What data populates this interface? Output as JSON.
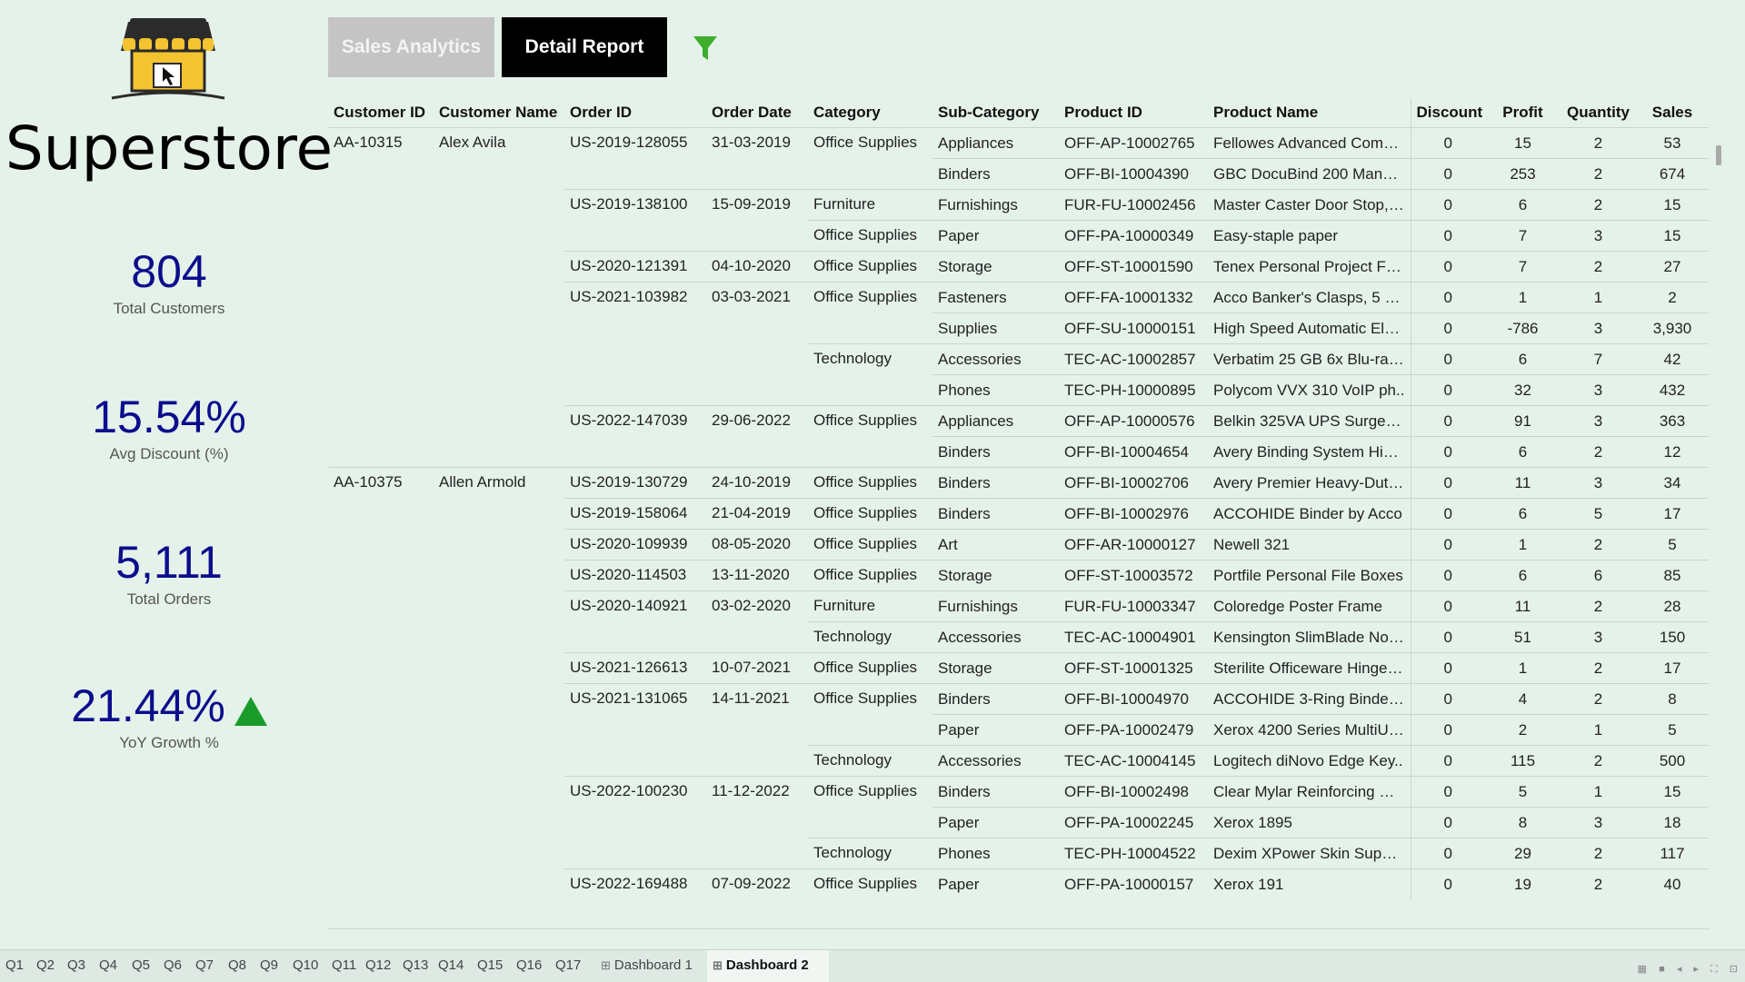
{
  "brand": {
    "title": "Superstore"
  },
  "kpis": {
    "customers": {
      "value": "804",
      "label": "Total Customers"
    },
    "discount": {
      "value": "15.54%",
      "label": "Avg Discount (%)"
    },
    "orders": {
      "value": "5,111",
      "label": "Total Orders"
    },
    "growth": {
      "value": "21.44%",
      "label": "YoY Growth %",
      "trend": "up",
      "arrow_color": "#1a9c2a"
    }
  },
  "nav": {
    "sales_label": "Sales Analytics",
    "detail_label": "Detail Report",
    "filter_icon": "filter-icon",
    "filter_color": "#3dae2b"
  },
  "table": {
    "headers": [
      "Customer ID",
      "Customer Name",
      "Order ID",
      "Order Date",
      "Category",
      "Sub-Category",
      "Product ID",
      "Product Name",
      "Discount",
      "Profit",
      "Quantity",
      "Sales"
    ],
    "rows": [
      [
        "AA-10315",
        "Alex Avila",
        "US-2019-128055",
        "31-03-2019",
        "Office Supplies",
        "Appliances",
        "OFF-AP-10002765",
        "Fellowes Advanced Compu..",
        "0",
        "15",
        "2",
        "53"
      ],
      [
        "",
        "",
        "",
        "",
        "",
        "Binders",
        "OFF-BI-10004390",
        "GBC DocuBind 200 Manual..",
        "0",
        "253",
        "2",
        "674"
      ],
      [
        "",
        "",
        "US-2019-138100",
        "15-09-2019",
        "Furniture",
        "Furnishings",
        "FUR-FU-10002456",
        "Master Caster Door Stop, L..",
        "0",
        "6",
        "2",
        "15"
      ],
      [
        "",
        "",
        "",
        "",
        "Office Supplies",
        "Paper",
        "OFF-PA-10000349",
        "Easy-staple paper",
        "0",
        "7",
        "3",
        "15"
      ],
      [
        "",
        "",
        "US-2020-121391",
        "04-10-2020",
        "Office Supplies",
        "Storage",
        "OFF-ST-10001590",
        "Tenex Personal Project File..",
        "0",
        "7",
        "2",
        "27"
      ],
      [
        "",
        "",
        "US-2021-103982",
        "03-03-2021",
        "Office Supplies",
        "Fasteners",
        "OFF-FA-10001332",
        "Acco Banker's Clasps, 5 3/..",
        "0",
        "1",
        "1",
        "2"
      ],
      [
        "",
        "",
        "",
        "",
        "",
        "Supplies",
        "OFF-SU-10000151",
        "High Speed Automatic Elec..",
        "0",
        "-786",
        "3",
        "3,930"
      ],
      [
        "",
        "",
        "",
        "",
        "Technology",
        "Accessories",
        "TEC-AC-10002857",
        "Verbatim 25 GB 6x Blu-ray ..",
        "0",
        "6",
        "7",
        "42"
      ],
      [
        "",
        "",
        "",
        "",
        "",
        "Phones",
        "TEC-PH-10000895",
        "Polycom VVX 310 VoIP ph..",
        "0",
        "32",
        "3",
        "432"
      ],
      [
        "",
        "",
        "US-2022-147039",
        "29-06-2022",
        "Office Supplies",
        "Appliances",
        "OFF-AP-10000576",
        "Belkin 325VA UPS Surge P..",
        "0",
        "91",
        "3",
        "363"
      ],
      [
        "",
        "",
        "",
        "",
        "",
        "Binders",
        "OFF-BI-10004654",
        "Avery Binding System Hidd..",
        "0",
        "6",
        "2",
        "12"
      ],
      [
        "AA-10375",
        "Allen Armold",
        "US-2019-130729",
        "24-10-2019",
        "Office Supplies",
        "Binders",
        "OFF-BI-10002706",
        "Avery Premier Heavy-Duty ..",
        "0",
        "11",
        "3",
        "34"
      ],
      [
        "",
        "",
        "US-2019-158064",
        "21-04-2019",
        "Office Supplies",
        "Binders",
        "OFF-BI-10002976",
        "ACCOHIDE Binder by Acco",
        "0",
        "6",
        "5",
        "17"
      ],
      [
        "",
        "",
        "US-2020-109939",
        "08-05-2020",
        "Office Supplies",
        "Art",
        "OFF-AR-10000127",
        "Newell 321",
        "0",
        "1",
        "2",
        "5"
      ],
      [
        "",
        "",
        "US-2020-114503",
        "13-11-2020",
        "Office Supplies",
        "Storage",
        "OFF-ST-10003572",
        "Portfile Personal File Boxes",
        "0",
        "6",
        "6",
        "85"
      ],
      [
        "",
        "",
        "US-2020-140921",
        "03-02-2020",
        "Furniture",
        "Furnishings",
        "FUR-FU-10003347",
        "Coloredge Poster Frame",
        "0",
        "11",
        "2",
        "28"
      ],
      [
        "",
        "",
        "",
        "",
        "Technology",
        "Accessories",
        "TEC-AC-10004901",
        "Kensington SlimBlade Note..",
        "0",
        "51",
        "3",
        "150"
      ],
      [
        "",
        "",
        "US-2021-126613",
        "10-07-2021",
        "Office Supplies",
        "Storage",
        "OFF-ST-10001325",
        "Sterilite Officeware Hinged ..",
        "0",
        "1",
        "2",
        "17"
      ],
      [
        "",
        "",
        "US-2021-131065",
        "14-11-2021",
        "Office Supplies",
        "Binders",
        "OFF-BI-10004970",
        "ACCOHIDE 3-Ring Binder, ..",
        "0",
        "4",
        "2",
        "8"
      ],
      [
        "",
        "",
        "",
        "",
        "",
        "Paper",
        "OFF-PA-10002479",
        "Xerox 4200 Series MultiUs..",
        "0",
        "2",
        "1",
        "5"
      ],
      [
        "",
        "",
        "",
        "",
        "Technology",
        "Accessories",
        "TEC-AC-10004145",
        "Logitech diNovo Edge Key..",
        "0",
        "115",
        "2",
        "500"
      ],
      [
        "",
        "",
        "US-2022-100230",
        "11-12-2022",
        "Office Supplies",
        "Binders",
        "OFF-BI-10002498",
        "Clear Mylar Reinforcing Stri..",
        "0",
        "5",
        "1",
        "15"
      ],
      [
        "",
        "",
        "",
        "",
        "",
        "Paper",
        "OFF-PA-10002245",
        "Xerox 1895",
        "0",
        "8",
        "3",
        "18"
      ],
      [
        "",
        "",
        "",
        "",
        "Technology",
        "Phones",
        "TEC-PH-10004522",
        "Dexim XPower Skin Super-..",
        "0",
        "29",
        "2",
        "117"
      ],
      [
        "",
        "",
        "US-2022-169488",
        "07-09-2022",
        "Office Supplies",
        "Paper",
        "OFF-PA-10000157",
        "Xerox 191",
        "0",
        "19",
        "2",
        "40"
      ]
    ]
  },
  "tabs": [
    "Q1",
    "Q2",
    "Q3",
    "Q4",
    "Q5",
    "Q6",
    "Q7",
    "Q8",
    "Q9",
    "Q10",
    "Q11",
    "Q12",
    "Q13",
    "Q14",
    "Q15",
    "Q16",
    "Q17",
    "Dashboard 1",
    "Dashboard 2"
  ],
  "active_tab": "Dashboard 2"
}
